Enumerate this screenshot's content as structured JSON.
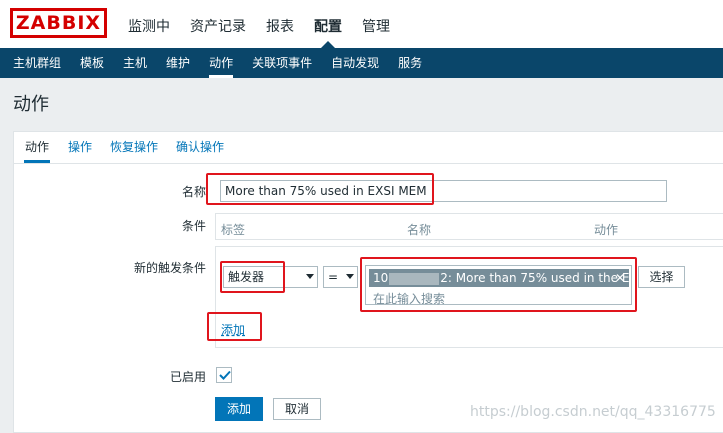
{
  "app": {
    "logo": "ZABBIX"
  },
  "top_menu": [
    {
      "label": "监测中"
    },
    {
      "label": "资产记录"
    },
    {
      "label": "报表"
    },
    {
      "label": "配置"
    },
    {
      "label": "管理"
    }
  ],
  "sub_nav": [
    {
      "label": "主机群组"
    },
    {
      "label": "模板"
    },
    {
      "label": "主机"
    },
    {
      "label": "维护"
    },
    {
      "label": "动作"
    },
    {
      "label": "关联项事件"
    },
    {
      "label": "自动发现"
    },
    {
      "label": "服务"
    }
  ],
  "page_title": "动作",
  "tabs": [
    {
      "label": "动作"
    },
    {
      "label": "操作"
    },
    {
      "label": "恢复操作"
    },
    {
      "label": "确认操作"
    }
  ],
  "form": {
    "name_label": "名称",
    "name_value": "More than 75% used in EXSI MEM",
    "conditions_label": "条件",
    "conditions_headers": {
      "label": "标签",
      "name": "名称",
      "action": "动作"
    },
    "new_condition_label": "新的触发条件",
    "condition_type": "触发器",
    "operator": "=",
    "trigger_chip_prefix": "10",
    "trigger_chip_suffix": "2: More than 75% used in the E...",
    "search_placeholder": "在此输入搜索",
    "select_button": "选择",
    "add_link": "添加",
    "enabled_label": "已启用",
    "enabled_checked": true,
    "submit_button": "添加",
    "cancel_button": "取消"
  },
  "colors": {
    "brand_red": "#d40000",
    "nav_blue": "#0a466a",
    "primary_blue": "#0275b8",
    "highlight_red": "#e0151d"
  },
  "watermark": "https://blog.csdn.net/qq_43316775"
}
